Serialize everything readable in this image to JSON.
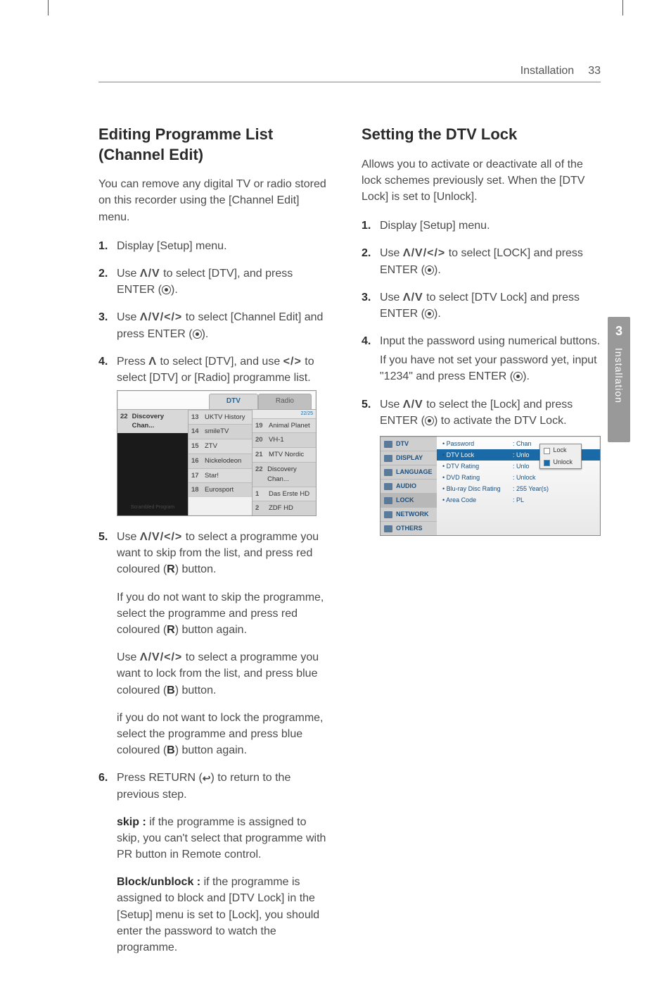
{
  "header": {
    "section": "Installation",
    "page_number": "33"
  },
  "side_tab": {
    "number": "3",
    "label": "Installation"
  },
  "left": {
    "heading": "Editing Programme List (Channel Edit)",
    "intro": "You can remove any digital TV or radio stored on this recorder using the [Channel Edit] menu.",
    "step1": "Display [Setup] menu.",
    "step2a": "Use ",
    "step2_arrows": "Λ/V",
    "step2b": " to select [DTV], and press ENTER (",
    "step2c": ").",
    "step3a": "Use ",
    "step3_arrows": "Λ/V/</>",
    "step3b": " to select [Channel Edit] and press ENTER (",
    "step3c": ").",
    "step4a": "Press ",
    "step4_arrow": "Λ",
    "step4b": " to select [DTV], and use ",
    "step4_arrows2": "</>",
    "step4c": " to select [DTV] or [Radio] programme list.",
    "step5a": "Use ",
    "step5_arrows": "Λ/V/</>",
    "step5b": " to select a programme you want to skip from the list, and press red coloured (",
    "step5_r": "R",
    "step5c": ") button.",
    "step5_p2a": "If you do not want to skip the programme, select the programme and press red coloured (",
    "step5_p2b": ") button again.",
    "step5_p3a": "Use ",
    "step5_p3b": " to select a programme you want to lock from the list, and press blue coloured (",
    "step5_b": "B",
    "step5_p3c": ") button.",
    "step5_p4a": "if you do not want to lock the programme, select the programme and press blue coloured (",
    "step5_p4b": ") button again.",
    "step6a": "Press RETURN (",
    "step6b": ") to return to the previous step.",
    "step6_skip_lbl": "skip :",
    "step6_skip": " if the programme is assigned to skip, you can't select that programme with PR button in Remote control.",
    "step6_block_lbl": "Block/unblock :",
    "step6_block": " if the programme is assigned to block and [DTV Lock] in the [Setup] menu is set to [Lock], you should enter the password to watch the programme."
  },
  "fig1": {
    "tab_dtv": "DTV",
    "tab_radio": "Radio",
    "counter": "22/25",
    "preview_num": "22",
    "preview_name": "Discovery Chan...",
    "scramble": "Scrambled Program",
    "listA": [
      {
        "n": "13",
        "t": "UKTV History"
      },
      {
        "n": "14",
        "t": "smileTV"
      },
      {
        "n": "15",
        "t": "ZTV"
      },
      {
        "n": "16",
        "t": "Nickelodeon"
      },
      {
        "n": "17",
        "t": "Star!"
      },
      {
        "n": "18",
        "t": "Eurosport"
      }
    ],
    "listB": [
      {
        "n": "19",
        "t": "Animal Planet"
      },
      {
        "n": "20",
        "t": "VH-1"
      },
      {
        "n": "21",
        "t": "MTV Nordic"
      },
      {
        "n": "22",
        "t": "Discovery Chan..."
      },
      {
        "n": "1",
        "t": "Das Erste HD"
      },
      {
        "n": "2",
        "t": "ZDF HD"
      }
    ]
  },
  "right": {
    "heading": "Setting the DTV Lock",
    "intro": "Allows you to activate or deactivate all of the lock schemes previously set. When the [DTV Lock] is set to [Unlock].",
    "step1": "Display [Setup] menu.",
    "step2a": "Use ",
    "step2_arrows": "Λ/V/</>",
    "step2b": " to select [LOCK] and press ENTER (",
    "step2c": ").",
    "step3a": "Use ",
    "step3_arrows": "Λ/V",
    "step3b": " to select [DTV Lock] and press ENTER (",
    "step3c": ").",
    "step4a": "Input the password using numerical buttons.",
    "step4b": "If you have not set your password yet, input \"1234\" and press ENTER (",
    "step4c": ").",
    "step5a": "Use ",
    "step5_arrows": "Λ/V",
    "step5b": " to select the [Lock] and press ENTER (",
    "step5c": ") to activate the DTV Lock."
  },
  "fig2": {
    "menu": [
      "DTV",
      "DISPLAY",
      "LANGUAGE",
      "AUDIO",
      "LOCK",
      "NETWORK",
      "OTHERS"
    ],
    "opts": [
      {
        "k": "Password",
        "v": ": Chan"
      },
      {
        "k": "DTV Lock",
        "v": ": Unlo",
        "hl": true
      },
      {
        "k": "DTV Rating",
        "v": ": Unlo"
      },
      {
        "k": "DVD Rating",
        "v": ": Unlock"
      },
      {
        "k": "Blu-ray Disc Rating",
        "v": ": 255 Year(s)"
      },
      {
        "k": "Area Code",
        "v": ": PL"
      }
    ],
    "popup": {
      "lock": "Lock",
      "unlock": "Unlock"
    }
  }
}
